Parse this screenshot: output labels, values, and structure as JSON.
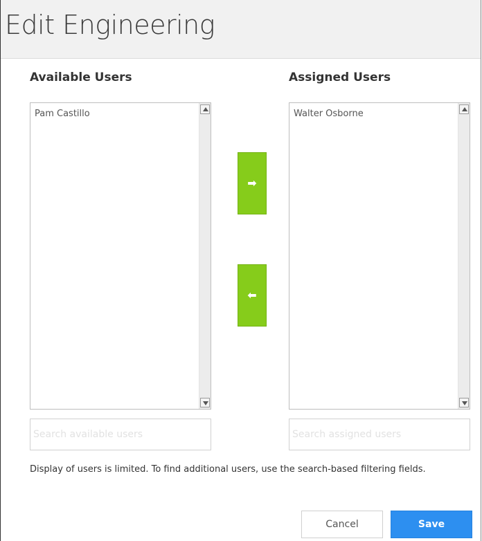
{
  "dialog": {
    "title": "Edit Engineering"
  },
  "available": {
    "heading": "Available Users",
    "items": [
      "Pam Castillo"
    ],
    "search_placeholder": "Search available users"
  },
  "assigned": {
    "heading": "Assigned Users",
    "items": [
      "Walter Osborne"
    ],
    "search_placeholder": "Search assigned users"
  },
  "controls": {
    "move_right_glyph": "➡",
    "move_left_glyph": "⬅"
  },
  "note": "Display of users is limited. To find additional users, use the search-based filtering fields.",
  "footer": {
    "cancel_label": "Cancel",
    "save_label": "Save"
  },
  "colors": {
    "move_button": "#86cc1b",
    "save_button": "#2d8ff0"
  }
}
